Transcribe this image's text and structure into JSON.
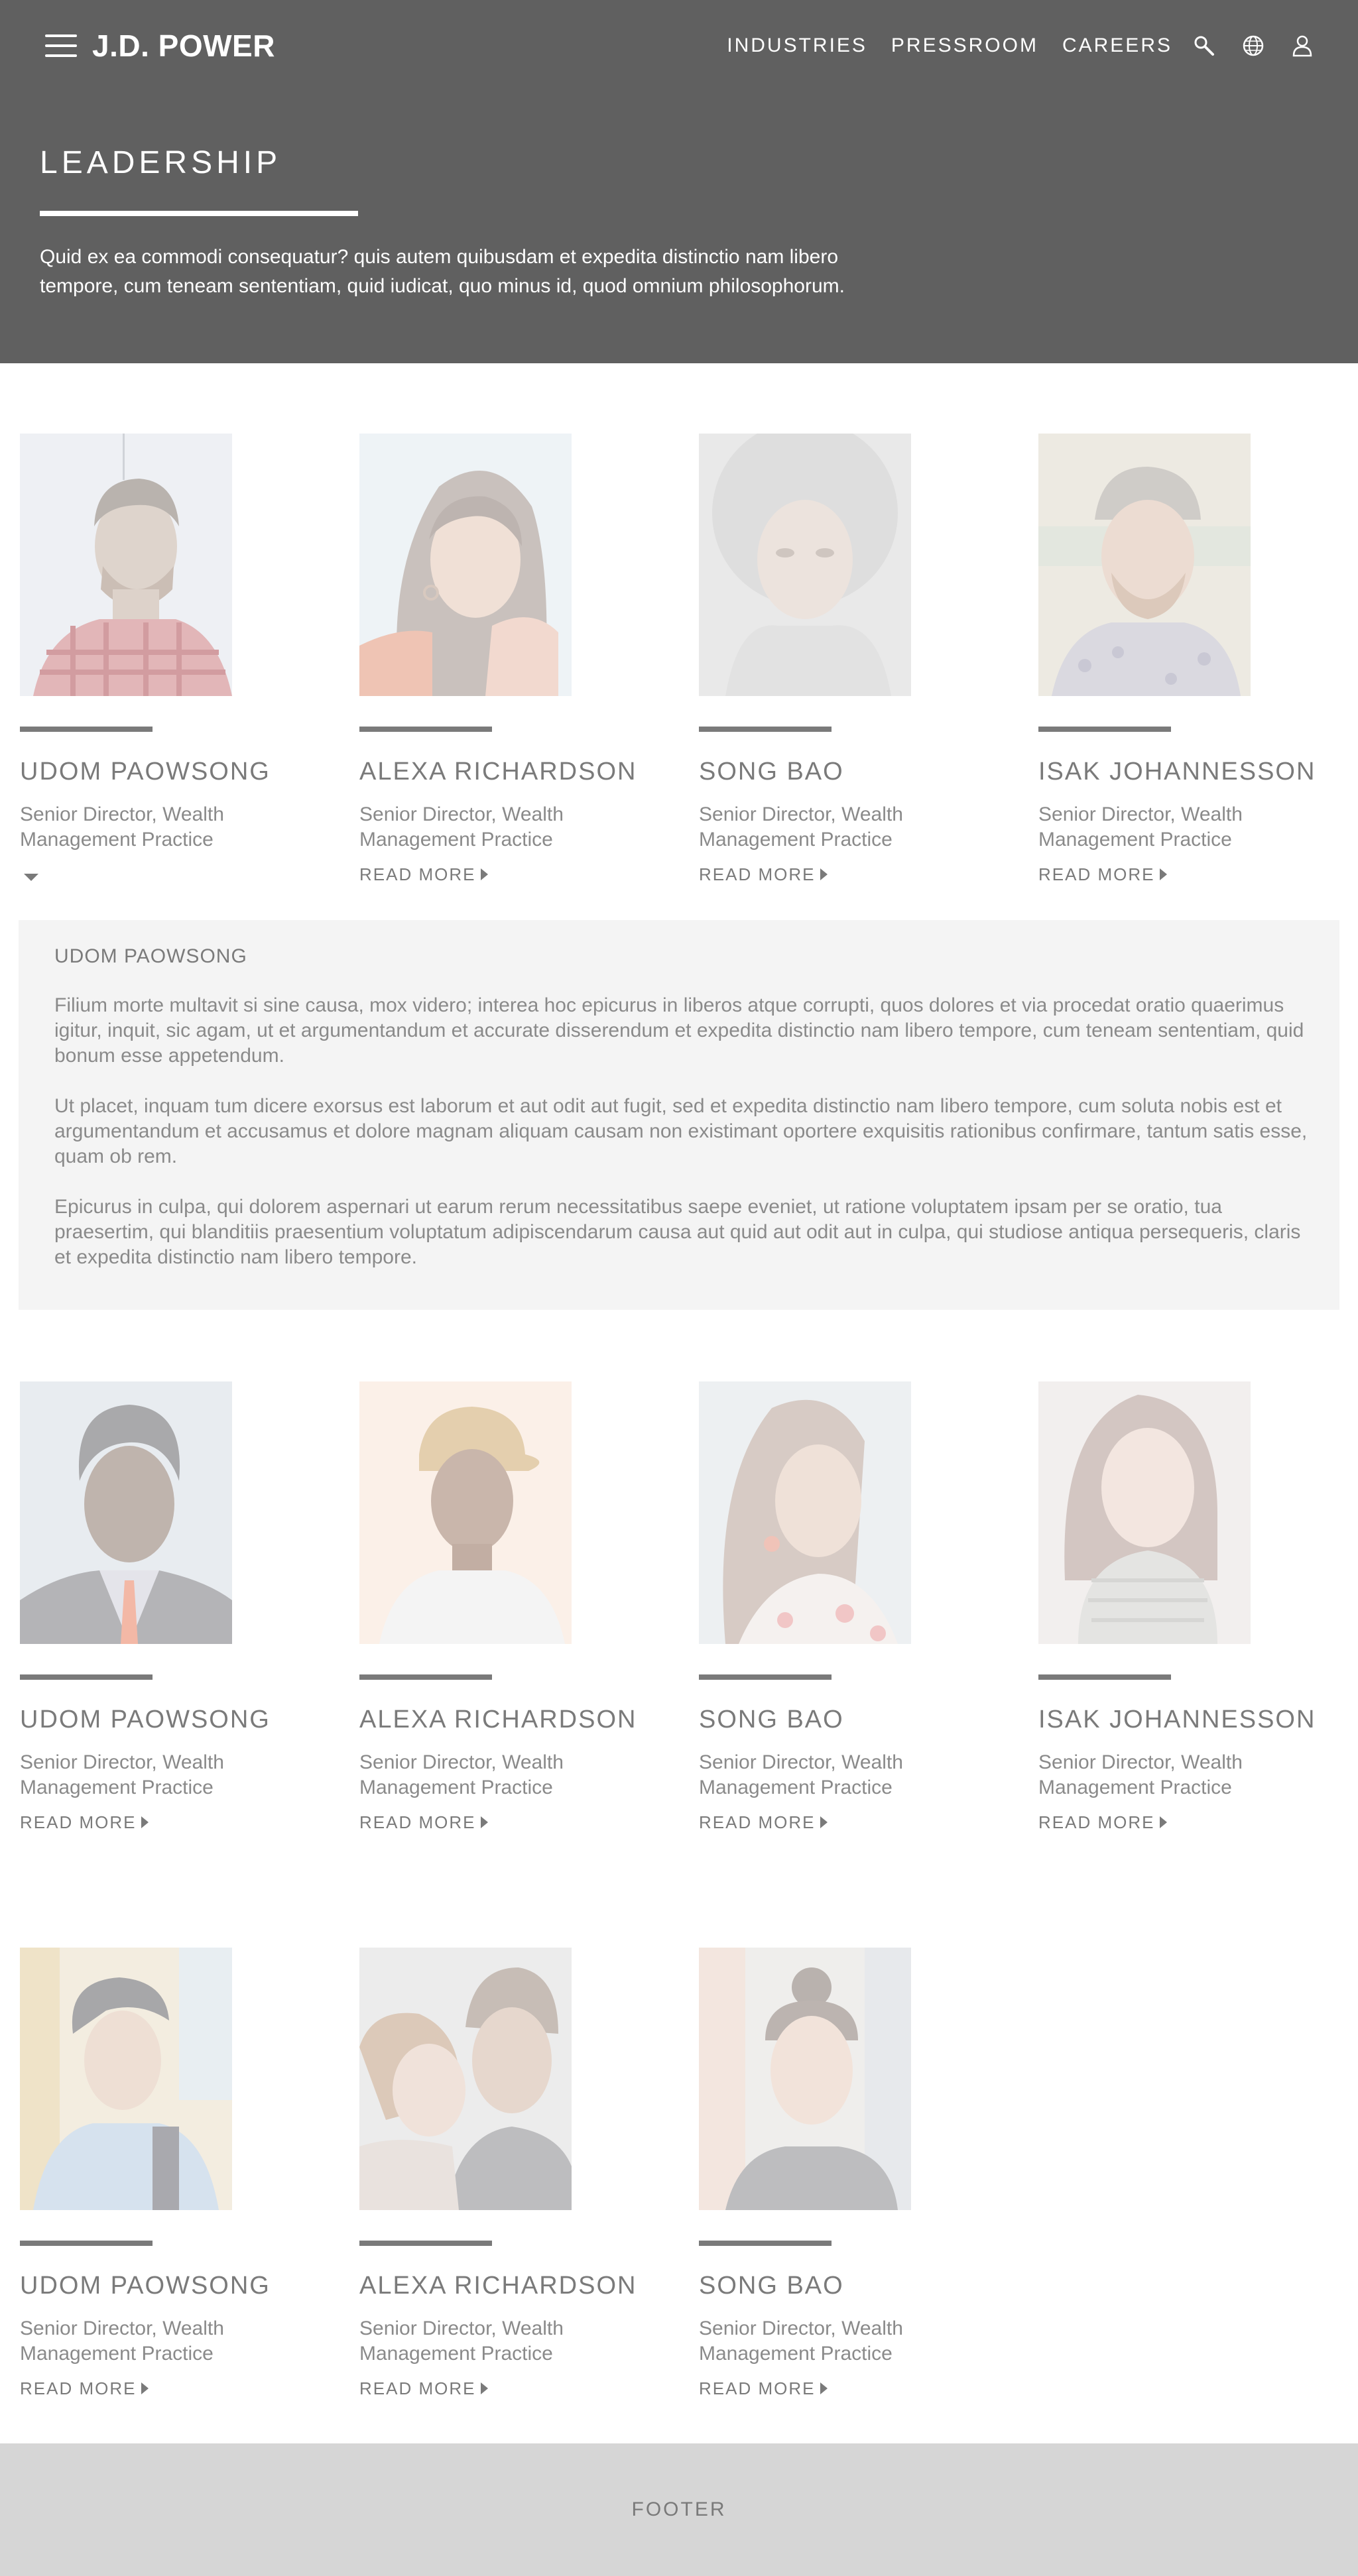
{
  "header": {
    "logo": "J.D. POWER",
    "nav": [
      "INDUSTRIES",
      "PRESSROOM",
      "CAREERS"
    ],
    "icons": [
      "search-icon",
      "globe-icon",
      "user-icon"
    ],
    "title": "LEADERSHIP",
    "intro": "Quid ex ea commodi consequatur? quis autem quibusdam et expedita distinctio nam libero tempore, cum teneam sententiam, quid iudicat, quo minus id, quod omnium philosophorum."
  },
  "colors": {
    "header_bg": "#606060",
    "text_gray": "#7a7a7a",
    "panel_bg": "#f4f4f4",
    "footer_bg": "#d6d6d6"
  },
  "leaders": [
    {
      "name": "UDOM PAOWSONG",
      "role": "Senior Director, Wealth Management Practice",
      "photo": "portrait-bearded-man-plaid",
      "expanded": true
    },
    {
      "name": "ALEXA RICHARDSON",
      "role": "Senior Director, Wealth Management Practice",
      "photo": "portrait-woman-long-hair",
      "read_more": "READ MORE"
    },
    {
      "name": "SONG BAO",
      "role": "Senior Director, Wealth Management Practice",
      "photo": "portrait-woman-curly-hair",
      "read_more": "READ MORE"
    },
    {
      "name": "ISAK JOHANNESSON",
      "role": "Senior Director, Wealth Management Practice",
      "photo": "portrait-man-cap-smiling",
      "read_more": "READ MORE"
    },
    {
      "name": "UDOM PAOWSONG",
      "role": "Senior Director, Wealth Management Practice",
      "photo": "portrait-man-suit",
      "read_more": "READ MORE"
    },
    {
      "name": "ALEXA RICHARDSON",
      "role": "Senior Director, Wealth Management Practice",
      "photo": "portrait-man-yellow-cap",
      "read_more": "READ MORE"
    },
    {
      "name": "SONG BAO",
      "role": "Senior Director, Wealth Management Practice",
      "photo": "portrait-woman-laughing",
      "read_more": "READ MORE"
    },
    {
      "name": "ISAK JOHANNESSON",
      "role": "Senior Director, Wealth Management Practice",
      "photo": "portrait-woman-turtleneck",
      "read_more": "READ MORE"
    },
    {
      "name": "UDOM PAOWSONG",
      "role": "Senior Director, Wealth Management Practice",
      "photo": "portrait-man-backpack",
      "read_more": "READ MORE"
    },
    {
      "name": "ALEXA RICHARDSON",
      "role": "Senior Director, Wealth Management Practice",
      "photo": "portrait-couple",
      "read_more": "READ MORE"
    },
    {
      "name": "SONG BAO",
      "role": "Senior Director, Wealth Management Practice",
      "photo": "portrait-woman-hair-bun",
      "read_more": "READ MORE"
    }
  ],
  "bio": {
    "name": "UDOM PAOWSONG",
    "paragraphs": [
      "Filium morte multavit si sine causa, mox videro; interea hoc epicurus in liberos atque corrupti, quos dolores et via procedat oratio quaerimus igitur, inquit, sic agam, ut et argumentandum et accurate disserendum et expedita distinctio nam libero tempore, cum teneam sententiam, quid bonum esse appetendum.",
      "Ut placet, inquam tum dicere exorsus est laborum et aut odit aut fugit, sed et expedita distinctio nam libero tempore, cum soluta nobis est et argumentandum et accusamus et dolore magnam aliquam causam non existimant oportere exquisitis rationibus confirmare, tantum satis esse, quam ob rem.",
      "Epicurus in culpa, qui dolorem aspernari ut earum rerum necessitatibus saepe eveniet, ut ratione voluptatem ipsam per se oratio, tua praesertim, qui blanditiis praesentium voluptatum adipiscendarum causa aut quid aut odit aut in culpa, qui studiose antiqua persequeris, claris et expedita distinctio nam libero tempore."
    ]
  },
  "footer": {
    "label": "FOOTER"
  }
}
